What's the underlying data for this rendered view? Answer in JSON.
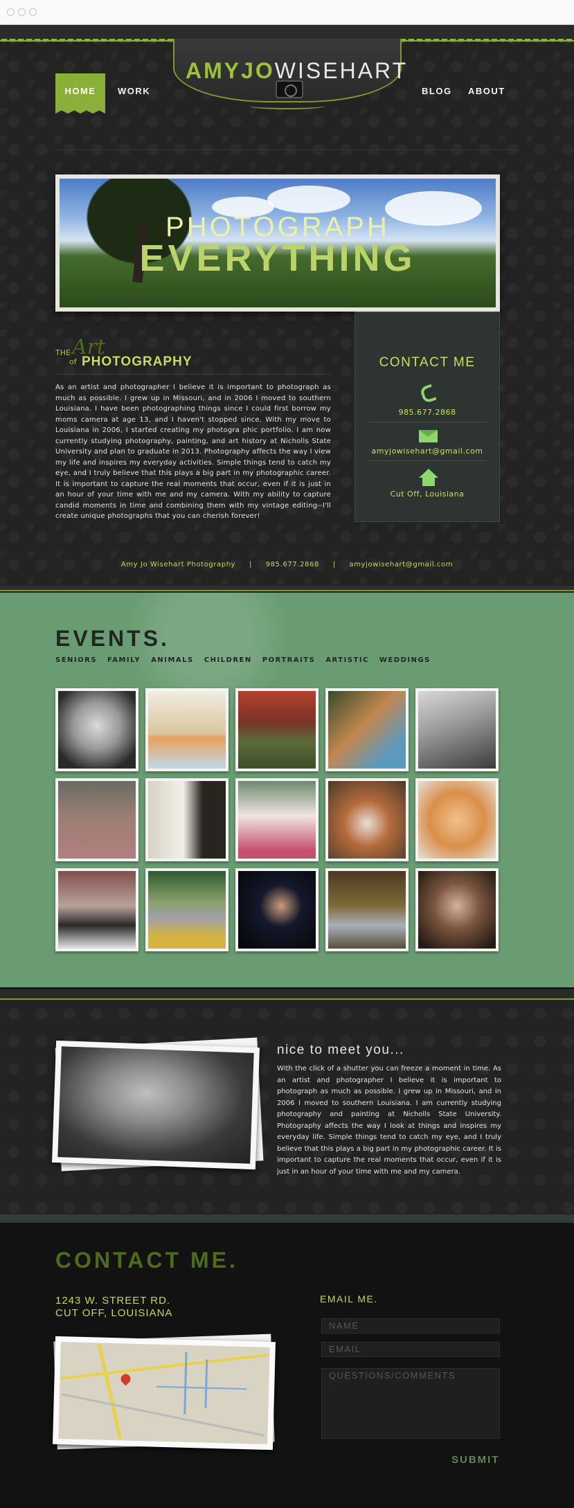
{
  "site": {
    "logo_first": "AMYJO",
    "logo_last": "WISEHART"
  },
  "nav": {
    "home": "HOME",
    "work": "WORK",
    "blog": "BLOG",
    "about": "ABOUT"
  },
  "hero": {
    "line1": "PHOTOGRAPH",
    "line2": "EVERYTHING"
  },
  "art": {
    "the": "THE",
    "of": "of",
    "script": "Art",
    "title": "PHOTOGRAPHY",
    "bio": "As an artist and photographer I believe it is important to photograph as much as possible. I grew up in Missouri, and in 2006 I moved to southern Louisiana. I have been photographing things since I could first borrow my moms camera at age 13, and I haven't stopped since. With my move to Louisiana in 2006, I started creating my photogra phic portfolio. I am now currently studying photography, painting, and art history at Nicholls State University and plan to graduate in 2013. Photography affects the way I view my life and inspires my everyday activities. Simple things tend to catch my eye, and I truly believe that this plays a big part in my photographic career. It is important to capture the real moments that occur, even if it is just in an hour of your time with me and my camera. With my ability to capture candid moments in time and combining them with my vintage editing--I'll create unique photographs that you can cherish forever!"
  },
  "contact_panel": {
    "title": "CONTACT ME",
    "phone": "985.677.2868",
    "email": "amyjowisehart@gmail.com",
    "location": "Cut Off, Louisiana"
  },
  "footer_line": {
    "name": "Amy Jo Wisehart Photography",
    "sep": "|",
    "phone": "985.677.2868",
    "email": "amyjowisehart@gmail.com"
  },
  "events": {
    "title": "EVENTS.",
    "categories": [
      "SENIORS",
      "FAMILY",
      "ANIMALS",
      "CHILDREN",
      "PORTRAITS",
      "ARTISTIC",
      "WEDDINGS"
    ],
    "photos": [
      "child-portrait",
      "dog-beach",
      "girl-lying-grass",
      "girl-sitting",
      "fabric-closeup",
      "bridesmaids",
      "wedding-couple",
      "bride-and-girl",
      "puppy",
      "cat-face",
      "girl-striped-shirt",
      "girl-yellow-skirt",
      "woman-dark-background",
      "girl-sitting-grass",
      "girl-closeup"
    ]
  },
  "about": {
    "title": "nice to meet you...",
    "text": "With the click of a shutter you can freeze a moment in time. As an artist and photographer I believe it is important to photograph as much as possible. I grew up in Missouri, and in 2006 I moved to southern Louisiana. I am currently studying photography and painting at Nicholls State University. Photography affects the way I look at things and inspires my everyday life. Simple things tend to catch my eye, and I truly believe that this plays a big part in my photographic career. It is important to capture the real moments that occur, even if it is just in an hour of your time with me and my camera."
  },
  "contact": {
    "title": "CONTACT ME.",
    "address1": "1243 W. STREET RD.",
    "address2": "CUT OFF, LOUISIANA",
    "email_label": "EMAIL ME.",
    "name_placeholder": "NAME",
    "email_placeholder": "EMAIL",
    "questions_placeholder": "QUESTIONS/COMMENTS",
    "submit": "SUBMIT"
  },
  "colors": {
    "accent_green": "#8bb03a",
    "events_bg": "#699c72",
    "dark_bg": "#232323"
  }
}
